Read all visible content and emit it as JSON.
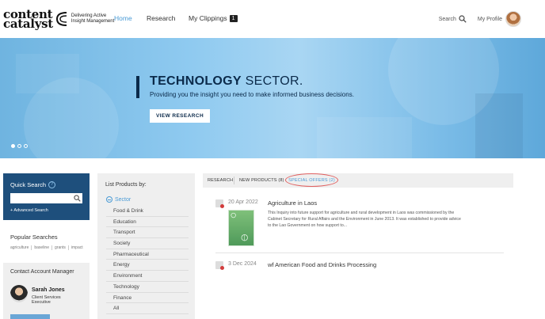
{
  "brand": {
    "logo_line1": "content",
    "logo_line2": "catalyst",
    "tagline_line1": "Delivering Active",
    "tagline_line2": "Insight Management"
  },
  "nav": {
    "home": "Home",
    "research": "Research",
    "clippings": "My Clippings",
    "clippings_count": "1"
  },
  "header_right": {
    "search": "Search",
    "profile": "My Profile"
  },
  "hero": {
    "title_bold": "TECHNOLOGY",
    "title_rest": " SECTOR.",
    "subtitle": "Providing you the insight you need to make informed business decisions.",
    "button": "VIEW RESEARCH",
    "active_slide": 1
  },
  "quick_search": {
    "title": "Quick Search",
    "help": "?",
    "advanced": "+ Advanced Search"
  },
  "popular_searches": {
    "title": "Popular Searches",
    "tags": [
      "agriculture",
      "baseline",
      "grants",
      "impact"
    ]
  },
  "account_manager": {
    "title": "Contact Account Manager",
    "name": "Sarah Jones",
    "role": "Client Services Executive"
  },
  "list_products": {
    "title": "List Products by:",
    "group": "Sector",
    "items": [
      "Food & Drink",
      "Education",
      "Transport",
      "Society",
      "Pharmaceutical",
      "Energy",
      "Environment",
      "Technology",
      "Finance",
      "All"
    ]
  },
  "tabs": {
    "research": "RESEARCH",
    "new_products": "NEW PRODUCTS (8)",
    "special_offers": "SPECIAL OFFERS (2)"
  },
  "results": [
    {
      "date": "20 Apr 2022",
      "title": "Agriculture in Laos",
      "description": "This Inquiry into future support for agriculture and rural development in Laos was commissioned by the Cabinet Secretary for Rural Affairs and the Environment in June 2013. It was established to provide advice to the Lao Government on how support to..."
    },
    {
      "date": "3 Dec 2024",
      "title": "wf American Food and Drinks Processing"
    }
  ],
  "colors": {
    "accent_blue": "#4a9bd6",
    "navy": "#0b2a4a",
    "quick_search_bg": "#1e4f7c",
    "highlight_red": "#e06060"
  }
}
